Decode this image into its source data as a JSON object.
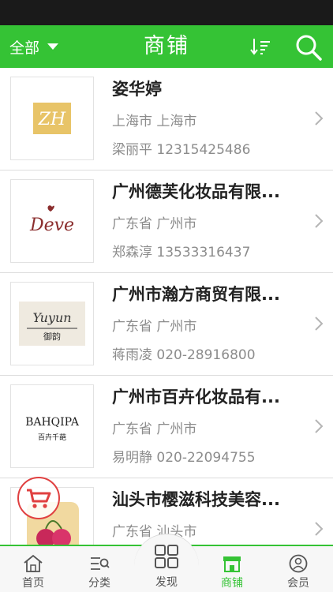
{
  "header": {
    "filter_label": "全部",
    "title": "商铺",
    "sort_icon": "sort-icon",
    "search_icon": "search-icon"
  },
  "shops": [
    {
      "name": "姿华婷",
      "region": "上海市 上海市",
      "contact": "梁丽平 12315425486",
      "logo": "ZH"
    },
    {
      "name": "广州德芙化妆品有限...",
      "region": "广东省 广州市",
      "contact": "郑森淳 13533316437",
      "logo": "Deve"
    },
    {
      "name": "广州市瀚方商贸有限...",
      "region": "广东省 广州市",
      "contact": "蒋雨凌 020-28916800",
      "logo": "Yuyun",
      "logo_sub": "御韵"
    },
    {
      "name": "广州市百卉化妆品有...",
      "region": "广东省 广州市",
      "contact": "易明静 020-22094755",
      "logo": "BAHQIPA",
      "logo_sub": "百卉千葩"
    },
    {
      "name": "汕头市樱滋科技美容...",
      "region": "广东省 汕头市",
      "contact": "",
      "logo": ""
    }
  ],
  "tabs": [
    {
      "label": "首页",
      "icon": "home-icon"
    },
    {
      "label": "分类",
      "icon": "category-icon"
    },
    {
      "label": "发现",
      "icon": "discover-icon"
    },
    {
      "label": "商铺",
      "icon": "shop-icon",
      "active": true
    },
    {
      "label": "会员",
      "icon": "member-icon"
    }
  ],
  "colors": {
    "accent": "#35c335",
    "cart": "#e04040"
  }
}
